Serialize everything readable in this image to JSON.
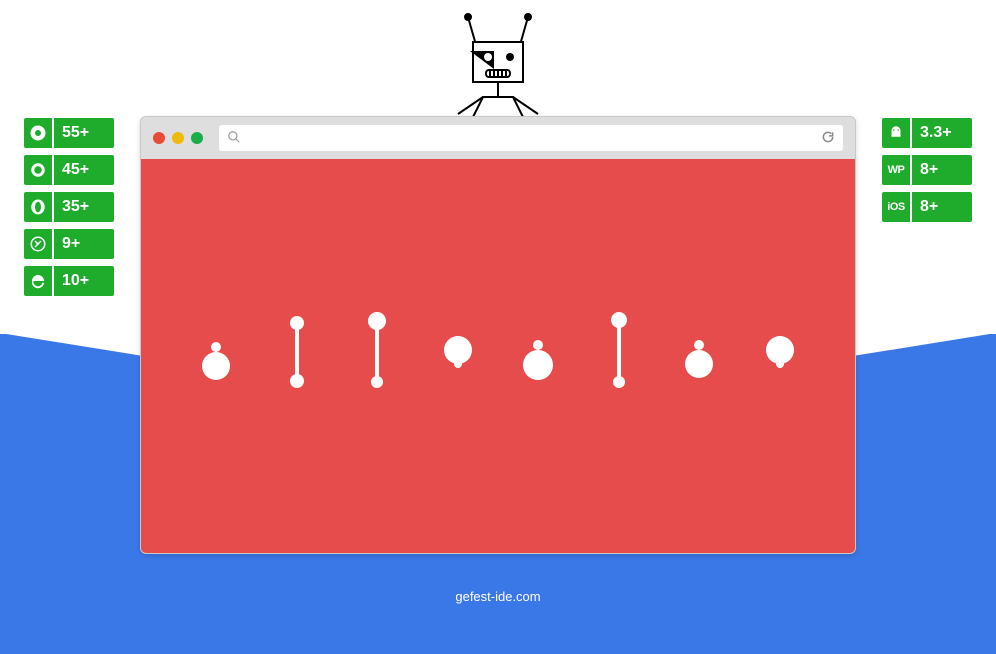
{
  "browsers_left": [
    {
      "icon": "chrome",
      "version": "55+"
    },
    {
      "icon": "firefox",
      "version": "45+"
    },
    {
      "icon": "opera",
      "version": "35+"
    },
    {
      "icon": "safari",
      "version": "9+"
    },
    {
      "icon": "ie",
      "version": "10+"
    }
  ],
  "browsers_right": [
    {
      "icon": "android",
      "version": "3.3+"
    },
    {
      "icon": "WP",
      "version": "8+"
    },
    {
      "icon": "iOS",
      "version": "8+"
    }
  ],
  "footer_text": "gefest-ide.com",
  "addr_placeholder": ""
}
